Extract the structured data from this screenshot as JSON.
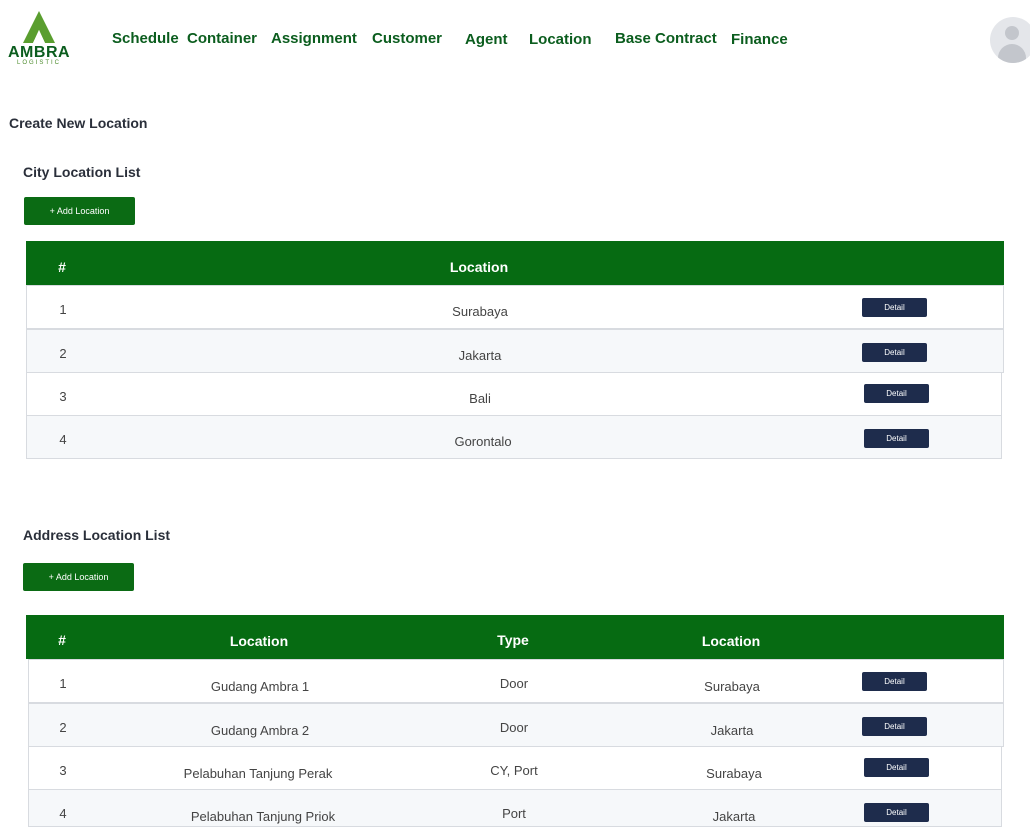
{
  "logo": {
    "brand": "AMBRA",
    "sub": "LOGISTIC"
  },
  "nav": {
    "items": [
      {
        "label": "Schedule"
      },
      {
        "label": "Container"
      },
      {
        "label": "Assignment"
      },
      {
        "label": "Customer"
      },
      {
        "label": "Agent"
      },
      {
        "label": "Location"
      },
      {
        "label": "Base Contract"
      },
      {
        "label": "Finance"
      }
    ]
  },
  "page": {
    "title": "Create New Location"
  },
  "city": {
    "title": "City Location List",
    "add_label": "+ Add Location",
    "headers": {
      "num": "#",
      "location": "Location"
    },
    "rows": [
      {
        "num": "1",
        "location": "Surabaya",
        "action": "Detail"
      },
      {
        "num": "2",
        "location": "Jakarta",
        "action": "Detail"
      },
      {
        "num": "3",
        "location": "Bali",
        "action": "Detail"
      },
      {
        "num": "4",
        "location": "Gorontalo",
        "action": "Detail"
      }
    ]
  },
  "address": {
    "title": "Address Location List",
    "add_label": "+ Add Location",
    "headers": {
      "num": "#",
      "location": "Location",
      "type": "Type",
      "city": "Location"
    },
    "rows": [
      {
        "num": "1",
        "location": "Gudang Ambra 1",
        "type": "Door",
        "city": "Surabaya",
        "action": "Detail"
      },
      {
        "num": "2",
        "location": "Gudang Ambra 2",
        "type": "Door",
        "city": "Jakarta",
        "action": "Detail"
      },
      {
        "num": "3",
        "location": "Pelabuhan Tanjung Perak",
        "type": "CY, Port",
        "city": "Surabaya",
        "action": "Detail"
      },
      {
        "num": "4",
        "location": "Pelabuhan Tanjung Priok",
        "type": "Port",
        "city": "Jakarta",
        "action": "Detail"
      }
    ]
  },
  "colors": {
    "brand_green": "#066b12",
    "nav_green": "#0b5d1e",
    "detail_navy": "#1e2c4c"
  }
}
